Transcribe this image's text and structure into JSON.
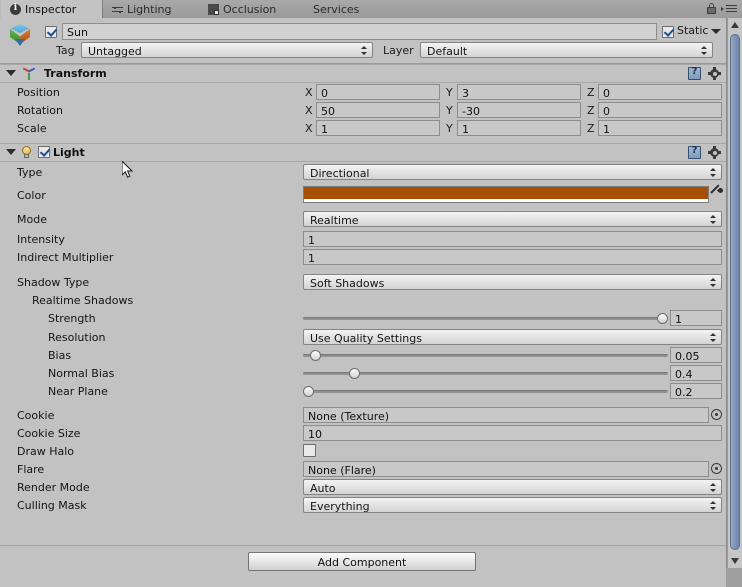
{
  "window": {
    "tabs": [
      {
        "label": "Inspector",
        "icon": "info-icon",
        "active": true
      },
      {
        "label": "Lighting",
        "icon": "sliders-icon",
        "active": false
      },
      {
        "label": "Occlusion",
        "icon": "occlusion-icon",
        "active": false
      },
      {
        "label": "Services",
        "icon": "",
        "active": false
      }
    ],
    "lock_icon": "lock-icon",
    "menu_icon": "hamburger-menu-icon"
  },
  "object_header": {
    "enabled": true,
    "name": "Sun",
    "static_label": "Static",
    "static_checked": true,
    "tag_label": "Tag",
    "tag_value": "Untagged",
    "layer_label": "Layer",
    "layer_value": "Default"
  },
  "transform": {
    "title": "Transform",
    "expanded": true,
    "axis_labels": [
      "X",
      "Y",
      "Z"
    ],
    "rows": [
      {
        "label": "Position",
        "x": "0",
        "y": "3",
        "z": "0"
      },
      {
        "label": "Rotation",
        "x": "50",
        "y": "-30",
        "z": "0"
      },
      {
        "label": "Scale",
        "x": "1",
        "y": "1",
        "z": "1"
      }
    ]
  },
  "light": {
    "title": "Light",
    "enabled": true,
    "expanded": true,
    "type": {
      "label": "Type",
      "value": "Directional"
    },
    "color": {
      "label": "Color",
      "value": "#a84f06",
      "alpha_bar": "#ffffff"
    },
    "mode": {
      "label": "Mode",
      "value": "Realtime"
    },
    "intensity": {
      "label": "Intensity",
      "value": "1"
    },
    "indirect_multiplier": {
      "label": "Indirect Multiplier",
      "value": "1"
    },
    "shadow_type": {
      "label": "Shadow Type",
      "value": "Soft Shadows"
    },
    "realtime_shadows_label": "Realtime Shadows",
    "strength": {
      "label": "Strength",
      "value": "1",
      "pct": 100
    },
    "resolution": {
      "label": "Resolution",
      "value": "Use Quality Settings"
    },
    "bias": {
      "label": "Bias",
      "value": "0.05",
      "pct": 2
    },
    "normal_bias": {
      "label": "Normal Bias",
      "value": "0.4",
      "pct": 13
    },
    "near_plane": {
      "label": "Near Plane",
      "value": "0.2",
      "pct": 0
    },
    "cookie": {
      "label": "Cookie",
      "value": "None (Texture)"
    },
    "cookie_size": {
      "label": "Cookie Size",
      "value": "10"
    },
    "draw_halo": {
      "label": "Draw Halo",
      "checked": false
    },
    "flare": {
      "label": "Flare",
      "value": "None (Flare)"
    },
    "render_mode": {
      "label": "Render Mode",
      "value": "Auto"
    },
    "culling_mask": {
      "label": "Culling Mask",
      "value": "Everything"
    }
  },
  "footer": {
    "add_component_label": "Add Component"
  }
}
